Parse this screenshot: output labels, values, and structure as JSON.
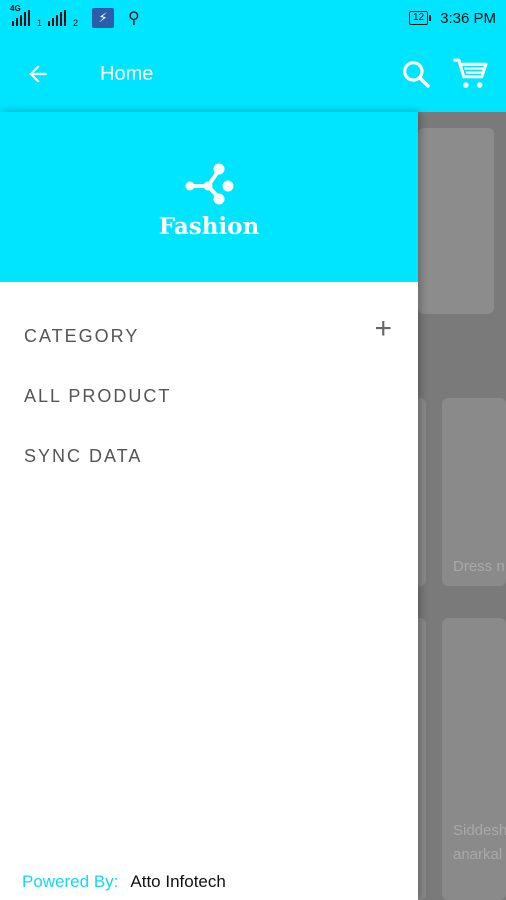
{
  "status_bar": {
    "network": "4G",
    "sim1": "1",
    "sim2": "2",
    "battery": "12",
    "time": "3:36 PM"
  },
  "app_bar": {
    "title": "Home"
  },
  "drawer": {
    "brand": "Fashion",
    "items": [
      {
        "label": "CATEGORY",
        "expand": "+"
      },
      {
        "label": "ALL PRODUCT"
      },
      {
        "label": "SYNC DATA"
      }
    ],
    "footer": {
      "powered_label": "Powered By:",
      "company": "Atto Infotech"
    }
  },
  "background": {
    "card_labels": [
      "Dress n",
      "Siddesh",
      "anarkal"
    ]
  },
  "colors": {
    "primary": "#00e5ff",
    "drawer_bg": "#ffffff",
    "menu_text": "#555555",
    "powered_text": "#17d5f0"
  },
  "icons": {
    "back": "arrow-left-icon",
    "search": "search-icon",
    "cart": "cart-icon",
    "logo": "share-nodes-icon",
    "expand": "plus-icon"
  }
}
